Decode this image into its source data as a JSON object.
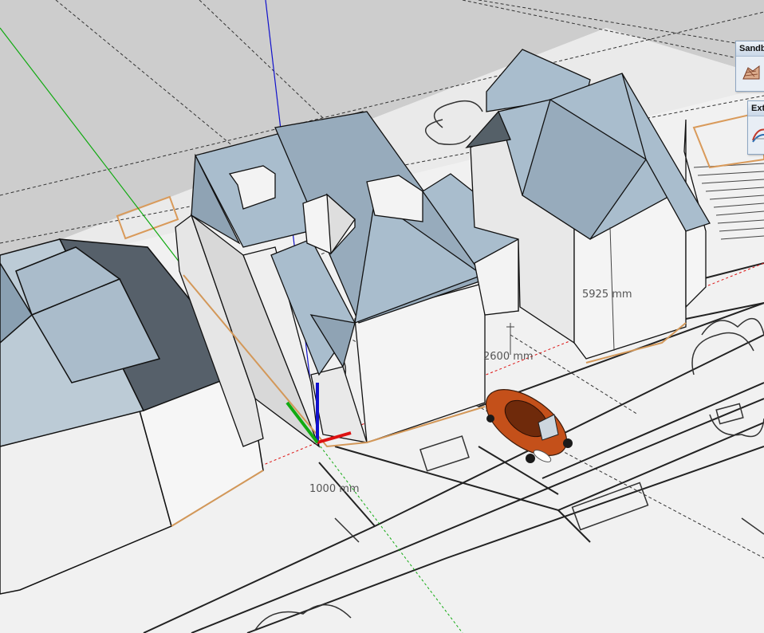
{
  "viewport": {
    "dimensions": [
      {
        "id": "dim-height",
        "text": "5925 mm"
      },
      {
        "id": "dim-width",
        "text": "2600 mm"
      },
      {
        "id": "dim-offset",
        "text": "1000 mm"
      }
    ]
  },
  "toolbars": [
    {
      "id": "sandbox",
      "title": "Sandb",
      "tool_icon": "sandbox-terrain-icon"
    },
    {
      "id": "extensions",
      "title": "Ext",
      "tool_icon": "extension-curve-icon"
    }
  ],
  "colors": {
    "ground": "#f1f1f1",
    "sky": "#cdcdcd",
    "roof": "#a9bdcd",
    "roof_shade": "#8fa3b4",
    "wall": "#f3f3f3",
    "wall_shade": "#d9d9d9",
    "car": "#c4501a",
    "axis_red": "#d11",
    "axis_green": "#1a1",
    "axis_blue": "#11c"
  }
}
